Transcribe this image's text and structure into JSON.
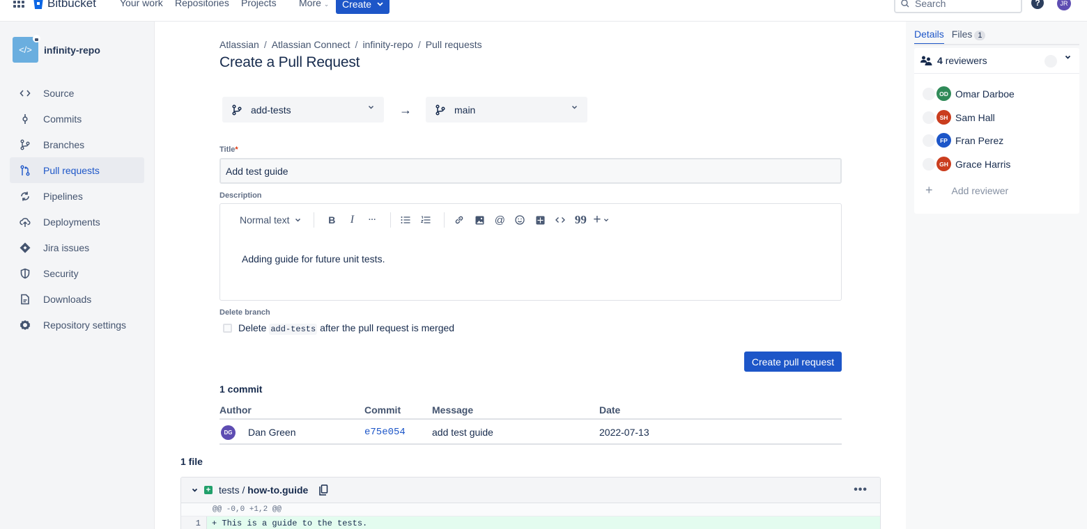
{
  "topnav": {
    "brand": "Bitbucket",
    "links": [
      "Your work",
      "Repositories",
      "Projects",
      "More"
    ],
    "create_label": "Create",
    "search_placeholder": "Search",
    "help_glyph": "?",
    "user_initials": "JR",
    "colors": {
      "primary": "#1d56c8",
      "user_avatar": "#5e4db2"
    }
  },
  "sidebar": {
    "repo_name": "infinity-repo",
    "repo_icon": "</>",
    "items": [
      {
        "label": "Source",
        "icon": "code-icon",
        "active": false
      },
      {
        "label": "Commits",
        "icon": "commit-icon",
        "active": false
      },
      {
        "label": "Branches",
        "icon": "branch-icon",
        "active": false
      },
      {
        "label": "Pull requests",
        "icon": "pull-request-icon",
        "active": true
      },
      {
        "label": "Pipelines",
        "icon": "refresh-icon",
        "active": false
      },
      {
        "label": "Deployments",
        "icon": "cloud-upload-icon",
        "active": false
      },
      {
        "label": "Jira issues",
        "icon": "jira-icon",
        "active": false
      },
      {
        "label": "Security",
        "icon": "shield-icon",
        "active": false
      },
      {
        "label": "Downloads",
        "icon": "document-icon",
        "active": false
      },
      {
        "label": "Repository settings",
        "icon": "gear-icon",
        "active": false
      }
    ]
  },
  "main": {
    "breadcrumbs": [
      "Atlassian",
      "Atlassian Connect",
      "infinity-repo",
      "Pull requests"
    ],
    "page_title": "Create a Pull Request",
    "source_branch": "add-tests",
    "target_branch": "main",
    "arrow": "→",
    "title_label": "Title",
    "title_required": "*",
    "title_value": "Add test guide",
    "description_label": "Description",
    "toolbar": {
      "text_style": "Normal text",
      "bold": "B",
      "italic": "I",
      "more": "···",
      "quote": "99",
      "insert": "+"
    },
    "description_value": "Adding guide for future unit tests.",
    "delete_branch_label": "Delete branch",
    "delete_branch_text_pre": "Delete",
    "delete_branch_code": "add-tests",
    "delete_branch_text_post": "after the pull request is merged",
    "delete_branch_checked": false,
    "create_button": "Create pull request",
    "commits_heading": "1 commit",
    "commit_columns": [
      "Author",
      "Commit",
      "Message",
      "Date"
    ],
    "commits": [
      {
        "initials": "DG",
        "author": "Dan Green",
        "hash": "e75e054",
        "message": "add test guide",
        "date": "2022-07-13",
        "avatar_color": "#5e4db2"
      }
    ],
    "files_heading": "1 file",
    "file": {
      "dir": "tests",
      "sep": "/",
      "name": "how-to.guide",
      "status": "added",
      "hunk": "@@ -0,0 +1,2 @@",
      "lines": [
        {
          "number": "1",
          "text": "+ This is a guide to the tests."
        }
      ]
    }
  },
  "right_panel": {
    "tabs": [
      {
        "label": "Details",
        "active": true
      },
      {
        "label": "Files",
        "badge": "1",
        "active": false
      }
    ],
    "reviewers_count": "4",
    "reviewers_label": "reviewers",
    "reviewers": [
      {
        "initials": "OD",
        "name": "Omar Darboe",
        "color": "#2f8a58"
      },
      {
        "initials": "SH",
        "name": "Sam Hall",
        "color": "#ca3d1e"
      },
      {
        "initials": "FP",
        "name": "Fran Perez",
        "color": "#1d56c8"
      },
      {
        "initials": "GH",
        "name": "Grace Harris",
        "color": "#ca3d1e"
      }
    ],
    "add_reviewer": "Add reviewer"
  }
}
